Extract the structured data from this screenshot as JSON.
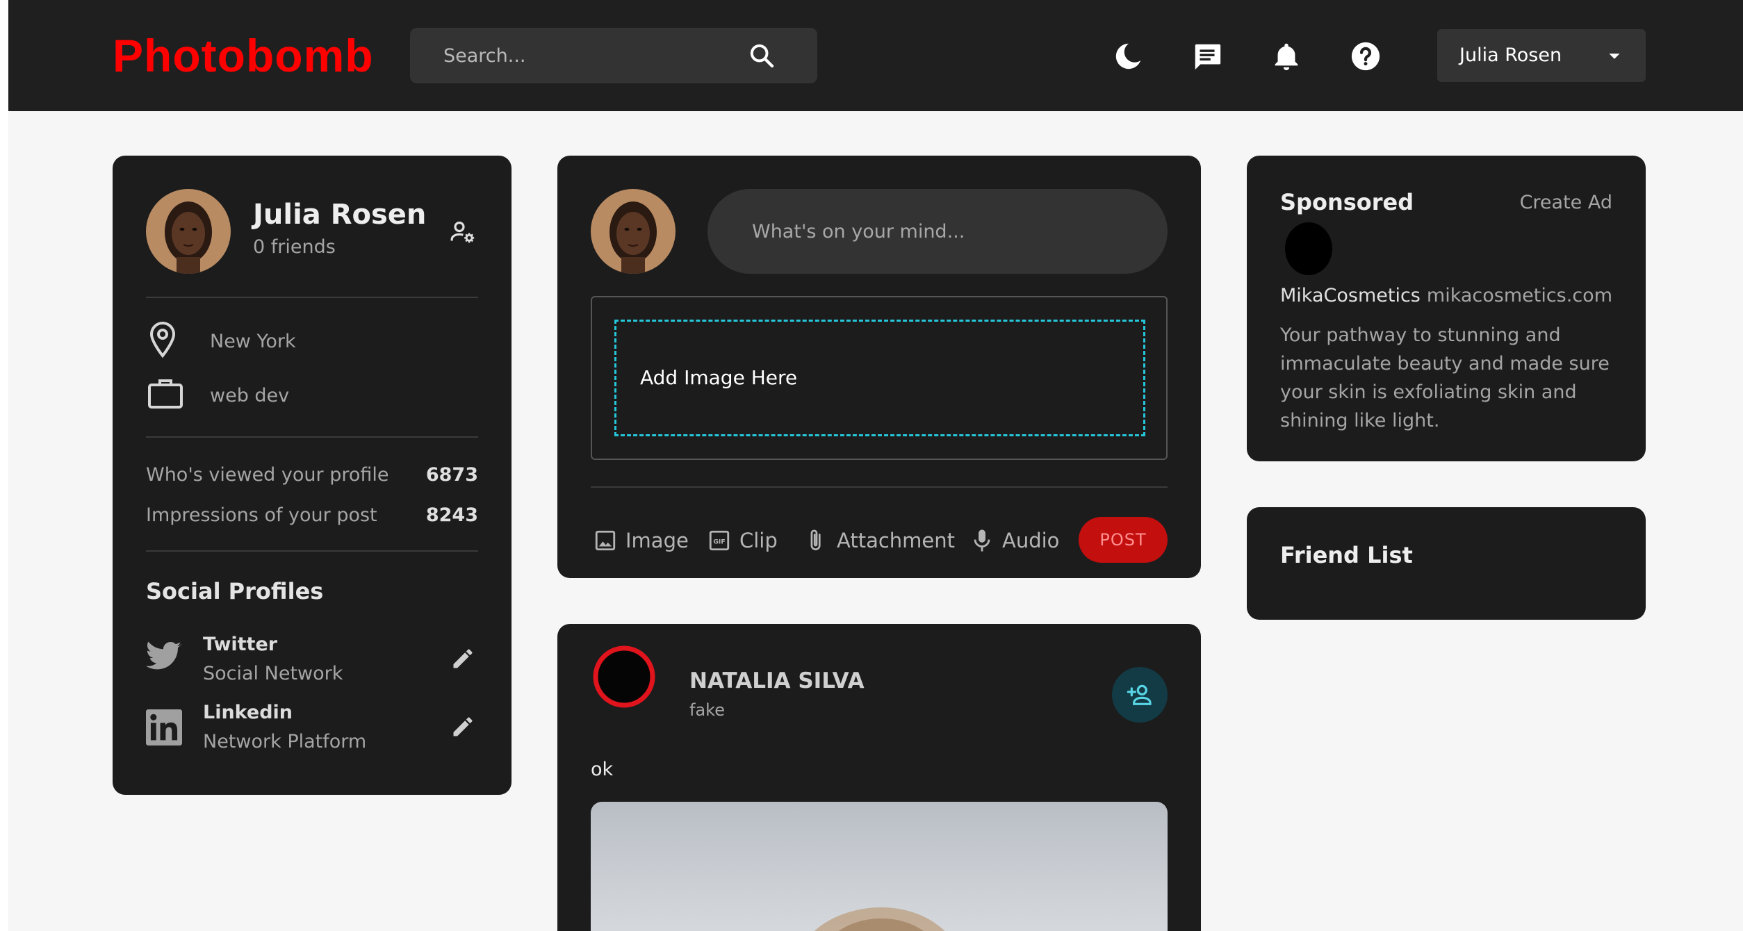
{
  "navbar": {
    "logo": "Photobomb",
    "search_placeholder": "Search...",
    "icons": [
      "moon-icon",
      "message-icon",
      "bell-icon",
      "help-icon"
    ],
    "user_name": "Julia Rosen"
  },
  "profile": {
    "name": "Julia Rosen",
    "friends": "0 friends",
    "location": "New York",
    "occupation": "web dev",
    "stats": [
      {
        "label": "Who's viewed your profile",
        "value": "6873"
      },
      {
        "label": "Impressions of your post",
        "value": "8243"
      }
    ],
    "social_title": "Social Profiles",
    "social": [
      {
        "name": "Twitter",
        "type": "Social Network"
      },
      {
        "name": "Linkedin",
        "type": "Network Platform"
      }
    ]
  },
  "composer": {
    "placeholder": "What's on your mind...",
    "drop_text": "Add Image Here",
    "tools": [
      "Image",
      "Clip",
      "Attachment",
      "Audio"
    ],
    "post_label": "POST"
  },
  "post": {
    "author": "NATALIA SILVA",
    "location": "fake",
    "text": "ok"
  },
  "sponsored": {
    "title": "Sponsored",
    "create_ad": "Create Ad",
    "brand": "MikaCosmetics",
    "url": "mikacosmetics.com",
    "description": "Your pathway to stunning and immaculate beauty and made sure your skin is exfoliating skin and shining like light."
  },
  "friend_list": {
    "title": "Friend List"
  },
  "colors": {
    "brand": "#ff0000",
    "card": "#1c1c1c",
    "navbar": "#1f1f1f",
    "accent_dash": "#26c6da",
    "post_button": "#c40f0f"
  }
}
